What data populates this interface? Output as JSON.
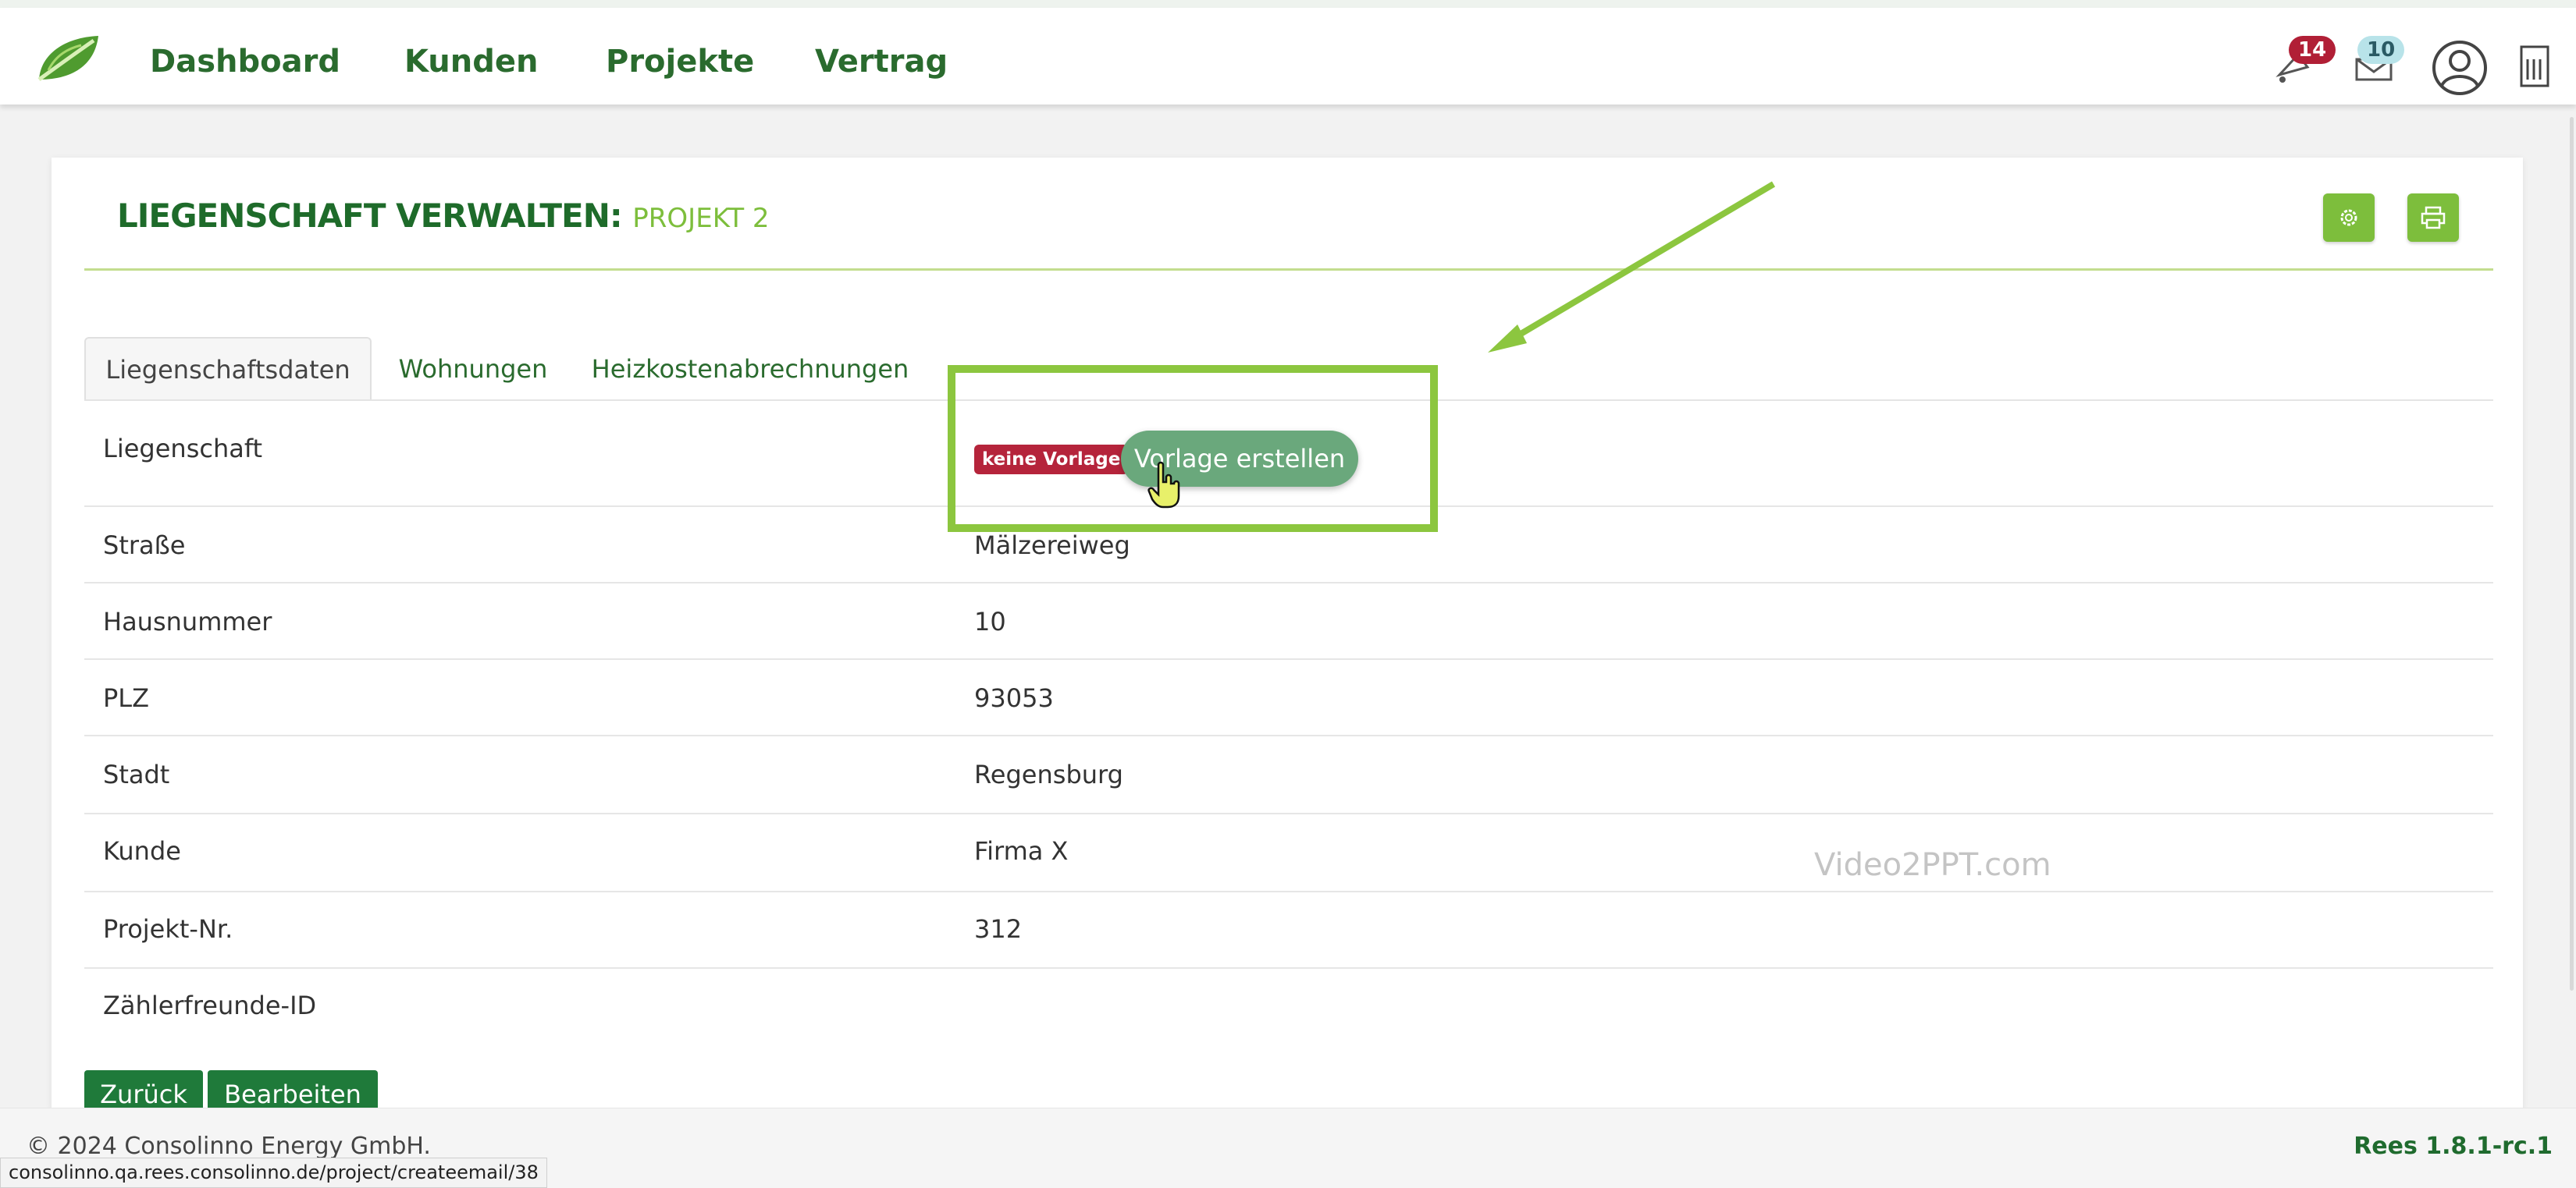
{
  "nav": {
    "items": [
      "Dashboard",
      "Kunden",
      "Projekte",
      "Vertrag"
    ],
    "notification_count": "14",
    "messages_count": "10"
  },
  "page": {
    "title": "LIEGENSCHAFT VERWALTEN:",
    "subtitle": "PROJEKT 2"
  },
  "tabs": [
    "Liegenschaftsdaten",
    "Wohnungen",
    "Heizkostenabrechnungen"
  ],
  "active_tab": "Liegenschaftsdaten",
  "template": {
    "badge": "keine Vorlage",
    "create_button": "Vorlage erstellen"
  },
  "rows": [
    {
      "label": "Liegenschaft",
      "value": ""
    },
    {
      "label": "Straße",
      "value": "Mälzereiweg"
    },
    {
      "label": "Hausnummer",
      "value": "10"
    },
    {
      "label": "PLZ",
      "value": "93053"
    },
    {
      "label": "Stadt",
      "value": "Regensburg"
    },
    {
      "label": "Kunde",
      "value": "Firma X"
    },
    {
      "label": "Projekt-Nr.",
      "value": "312"
    },
    {
      "label": "Zählerfreunde-ID",
      "value": ""
    }
  ],
  "buttons": {
    "back": "Zurück",
    "edit": "Bearbeiten"
  },
  "watermark": "Video2PPT.com",
  "footer": {
    "copyright": "© 2024 Consolinno Energy GmbH.",
    "version": "Rees 1.8.1-rc.1",
    "status_url": "consolinno.qa.rees.consolinno.de/project/createemail/38"
  },
  "colors": {
    "brand_dark": "#1e6b2a",
    "brand_light": "#7dbe3c",
    "badge_red": "#b5243b"
  }
}
